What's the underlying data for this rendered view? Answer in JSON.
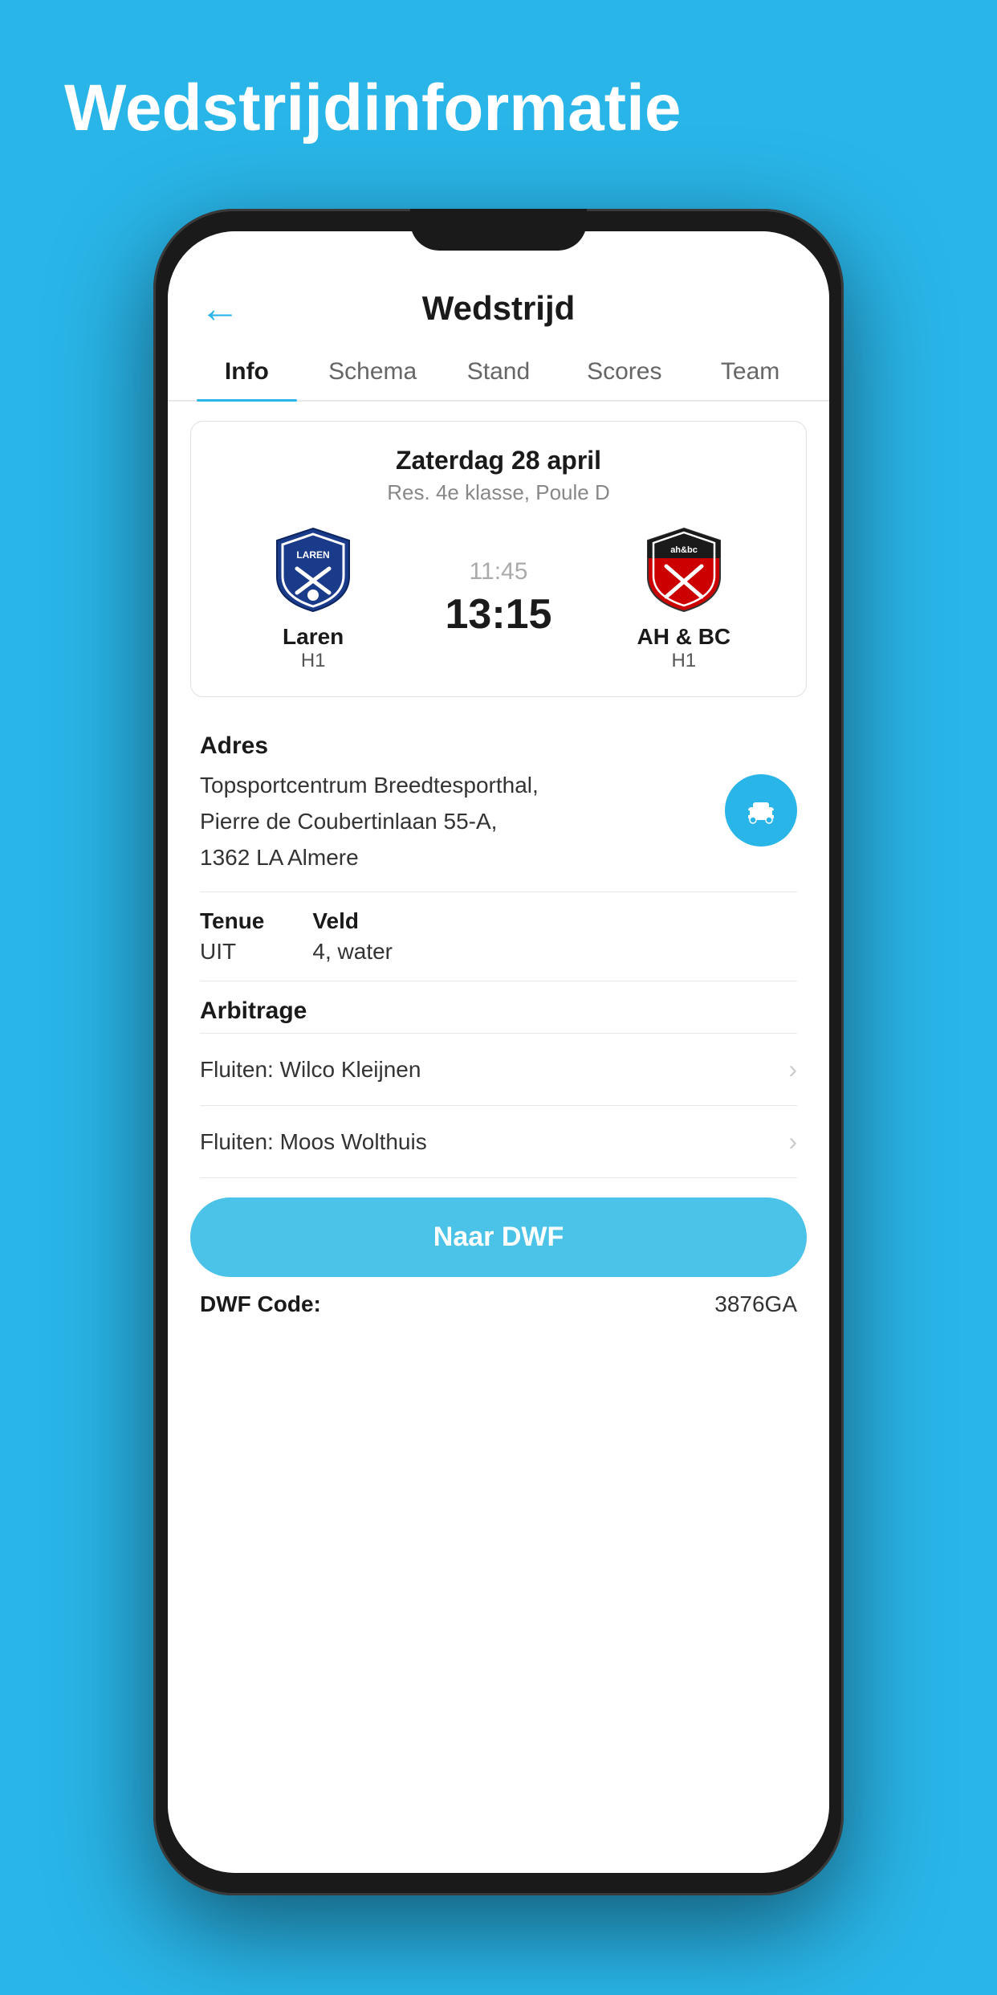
{
  "page": {
    "title": "Wedstrijdinformatie",
    "background_color": "#29b5e8"
  },
  "header": {
    "back_icon": "←",
    "title": "Wedstrijd"
  },
  "tabs": [
    {
      "id": "info",
      "label": "Info",
      "active": true
    },
    {
      "id": "schema",
      "label": "Schema",
      "active": false
    },
    {
      "id": "stand",
      "label": "Stand",
      "active": false
    },
    {
      "id": "scores",
      "label": "Scores",
      "active": false
    },
    {
      "id": "team",
      "label": "Team",
      "active": false
    }
  ],
  "match": {
    "date": "Zaterdag 28 april",
    "league": "Res. 4e klasse, Poule D",
    "home_team": {
      "name": "Laren",
      "sub": "H1"
    },
    "away_team": {
      "name": "AH & BC",
      "sub": "H1"
    },
    "time_scheduled": "11:45",
    "time_actual": "13:15"
  },
  "info": {
    "address_label": "Adres",
    "address_text": "Topsportcentrum Breedtesporthal,\nPierre de Coubertinlaan 55-A,\n1362 LA Almere",
    "tenue_label": "Tenue",
    "tenue_value": "UIT",
    "veld_label": "Veld",
    "veld_value": "4, water",
    "arbitrage_label": "Arbitrage",
    "referees": [
      {
        "label": "Fluiten: Wilco Kleijnen"
      },
      {
        "label": "Fluiten: Moos Wolthuis"
      }
    ],
    "naar_dwf_label": "Naar DWF",
    "dwf_code_label": "DWF Code:",
    "dwf_code_value": "3876GA"
  }
}
